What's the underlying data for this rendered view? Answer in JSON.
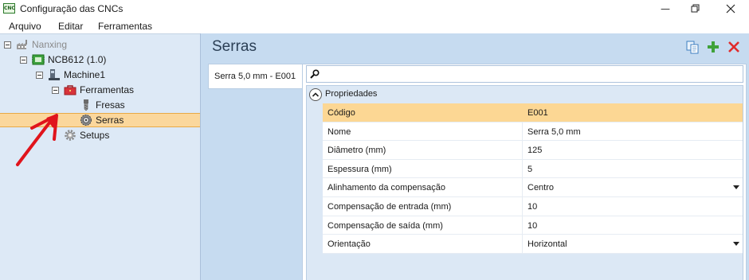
{
  "window": {
    "icon_text": "CNC",
    "title": "Configuração das CNCs"
  },
  "menu": [
    "Arquivo",
    "Editar",
    "Ferramentas"
  ],
  "tree": {
    "nodes": [
      {
        "label": "Nanxing",
        "icon": "factory-icon"
      },
      {
        "label": "NCB612 (1.0)",
        "icon": "cnc-board-icon"
      },
      {
        "label": "Machine1",
        "icon": "machine-icon"
      },
      {
        "label": "Ferramentas",
        "icon": "toolbox-icon"
      },
      {
        "label": "Fresas",
        "icon": "drill-bit-icon"
      },
      {
        "label": "Serras",
        "icon": "saw-blade-icon"
      },
      {
        "label": "Setups",
        "icon": "gear-icon"
      }
    ],
    "selected": "Serras"
  },
  "main": {
    "title": "Serras",
    "toolbar": [
      "copy-icon",
      "add-icon",
      "delete-icon"
    ],
    "tab_label": "Serra 5,0 mm - E001",
    "search": {
      "value": "",
      "placeholder": ""
    },
    "category": "Propriedades",
    "properties": [
      {
        "name": "Código",
        "value": "E001",
        "dropdown": false
      },
      {
        "name": "Nome",
        "value": "Serra 5,0 mm",
        "dropdown": false
      },
      {
        "name": "Diâmetro (mm)",
        "value": "125",
        "dropdown": false
      },
      {
        "name": "Espessura (mm)",
        "value": "5",
        "dropdown": false
      },
      {
        "name": "Alinhamento da compensação",
        "value": "Centro",
        "dropdown": true
      },
      {
        "name": "Compensação de entrada (mm)",
        "value": "10",
        "dropdown": false
      },
      {
        "name": "Compensação de saída (mm)",
        "value": "10",
        "dropdown": false
      },
      {
        "name": "Orientação",
        "value": "Horizontal",
        "dropdown": true
      }
    ]
  },
  "colors": {
    "tree_bg": "#dde9f6",
    "main_bg": "#c6dbf0",
    "selection": "#fbd79c",
    "annotation_arrow": "#e0141c"
  }
}
